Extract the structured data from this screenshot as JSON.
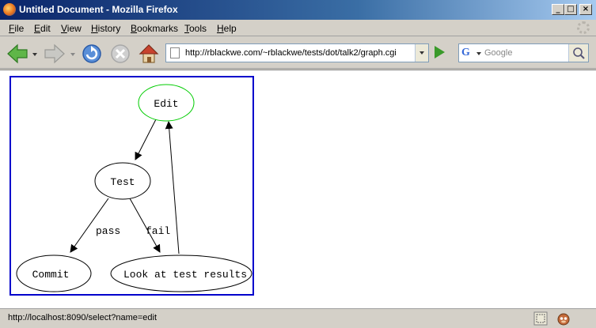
{
  "window": {
    "title": "Untitled Document - Mozilla Firefox"
  },
  "menubar": {
    "items": [
      {
        "label": "File",
        "key": "F",
        "rest": "ile"
      },
      {
        "label": "Edit",
        "key": "E",
        "rest": "dit"
      },
      {
        "label": "View",
        "key": "V",
        "rest": "iew"
      },
      {
        "label": "History",
        "key": "H",
        "rest": "istory"
      },
      {
        "label": "Bookmarks",
        "key": "B",
        "rest": "ookmarks"
      },
      {
        "label": "Tools",
        "key": "T",
        "rest": "ools"
      },
      {
        "label": "Help",
        "key": "H",
        "rest": "elp"
      }
    ]
  },
  "navbar": {
    "url": "http://rblackwe.com/~rblackwe/tests/dot/talk2/graph.cgi",
    "search_placeholder": "Google"
  },
  "graph": {
    "nodes": {
      "edit": "Edit",
      "test": "Test",
      "commit": "Commit",
      "look": "Look at test results"
    },
    "edges": {
      "pass": "pass",
      "fail": "fail"
    },
    "colors": {
      "edit_outline": "#00cc00",
      "default_outline": "#000000",
      "frame": "#0000cc"
    }
  },
  "statusbar": {
    "text": "http://localhost:8090/select?name=edit"
  }
}
